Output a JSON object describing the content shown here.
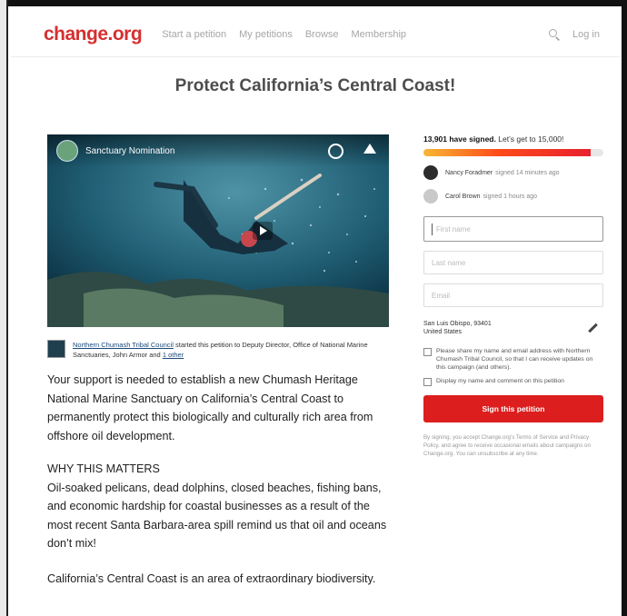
{
  "header": {
    "logo": "change.org",
    "nav": [
      "Start a petition",
      "My petitions",
      "Browse",
      "Membership"
    ],
    "search_icon": "search-icon",
    "login": "Log in"
  },
  "title": "Protect California’s Central Coast!",
  "video": {
    "title": "Sanctuary Nomination",
    "icons": [
      "clock-icon",
      "share-icon",
      "play-icon"
    ]
  },
  "started_by": {
    "starter": "Northern Chumash Tribal Council",
    "text": "started this petition to Deputy Director, Office of National Marine Sanctuaries, John Armor and",
    "recipient_suffix": "1 other"
  },
  "body": {
    "p1": "Your support is needed to establish a new Chumash Heritage National Marine Sanctuary on California’s Central Coast to permanently protect this biologically and culturally rich area from offshore oil development.",
    "h": "WHY THIS MATTERS",
    "p2": "Oil-soaked pelicans, dead dolphins, closed beaches, fishing bans, and economic hardship for coastal businesses as a result of the most recent Santa Barbara-area spill remind us that oil and oceans don’t mix!",
    "p3": "California’s Central Coast is an area of extraordinary biodiversity."
  },
  "sidebar": {
    "signed_count": "13,901 have signed.",
    "goal_text": "Let’s get to 15,000!",
    "progress_fraction": 0.93,
    "signers": [
      {
        "name": "Nancy Foradmer",
        "action": "signed 14 minutes ago"
      },
      {
        "name": "Carol Brown",
        "action": "signed 1 hours ago"
      }
    ],
    "fields": {
      "first_name": "First name",
      "last_name": "Last name",
      "email": "Email"
    },
    "location": "San Luis Obispo, 93401\nUnited States",
    "checkbox1": "Please share my name and email address with Northern Chumash Tribal Council, so that I can receive updates on this campaign (and others).",
    "checkbox2": "Display my name and comment on this petition",
    "sign_button": "Sign this petition",
    "disclaimer": "By signing, you accept Change.org’s Terms of Service and Privacy Policy, and agree to receive occasional emails about campaigns on Change.org. You can unsubscribe at any time.",
    "tos": "Terms of Service",
    "privacy": "Privacy Policy"
  }
}
